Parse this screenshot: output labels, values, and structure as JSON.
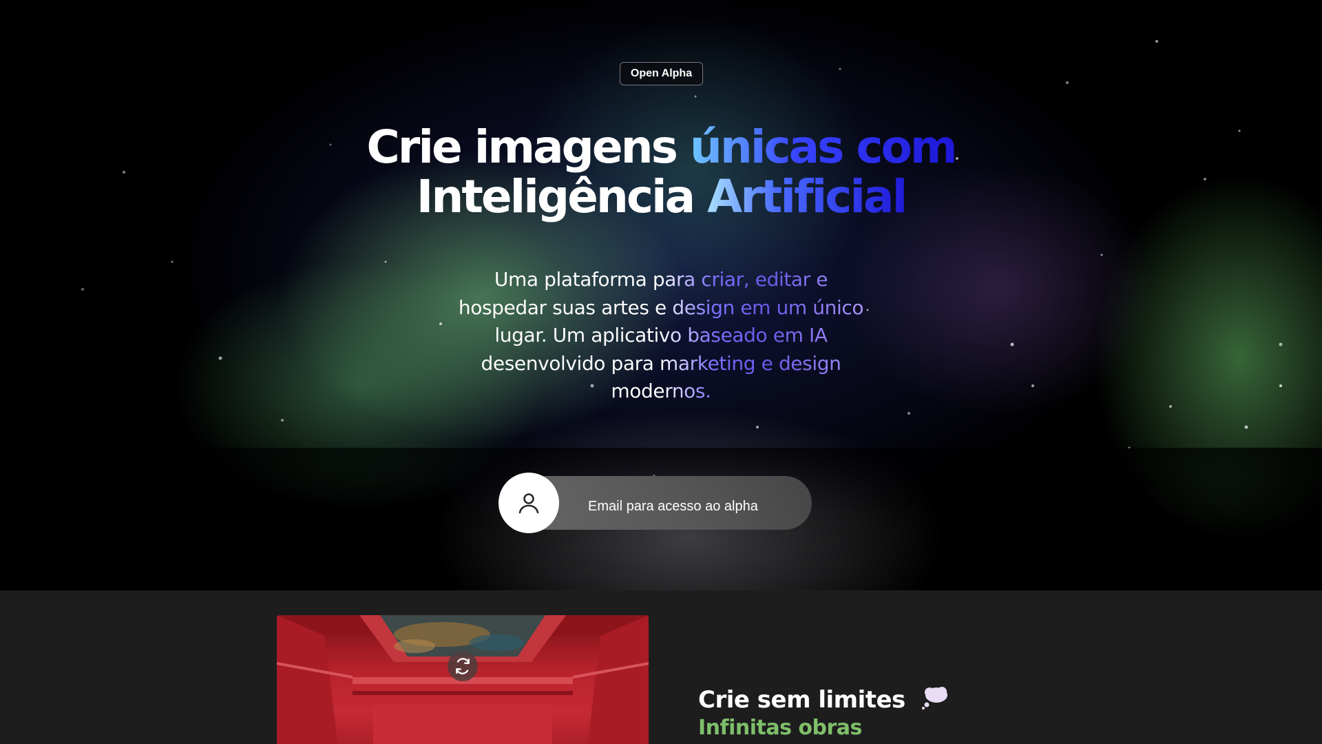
{
  "hero": {
    "badge": "Open Alpha",
    "headline": {
      "line1_white": "Crie imagens ",
      "line1_gradient": "únicas com",
      "line2_white": "Inteligência ",
      "line2_gradient": "Artificial"
    },
    "subtitle": "Uma plataforma para criar, editar e hospedar suas artes e design em um único lugar. Um aplicativo baseado em IA desenvolvido para marketing e design modernos.",
    "email": {
      "placeholder": "Email para acesso ao alpha",
      "icon": "user-icon"
    }
  },
  "feature": {
    "title": "Crie sem limites",
    "title_icon": "thought-bubble-icon",
    "subtitle": "Infinitas obras",
    "card_action_icon": "refresh-icon"
  },
  "colors": {
    "accent_blue": "#3844ff",
    "accent_purple": "#7e70ff",
    "accent_green": "#7fbf6a",
    "section_bg": "#1d1d1d"
  }
}
